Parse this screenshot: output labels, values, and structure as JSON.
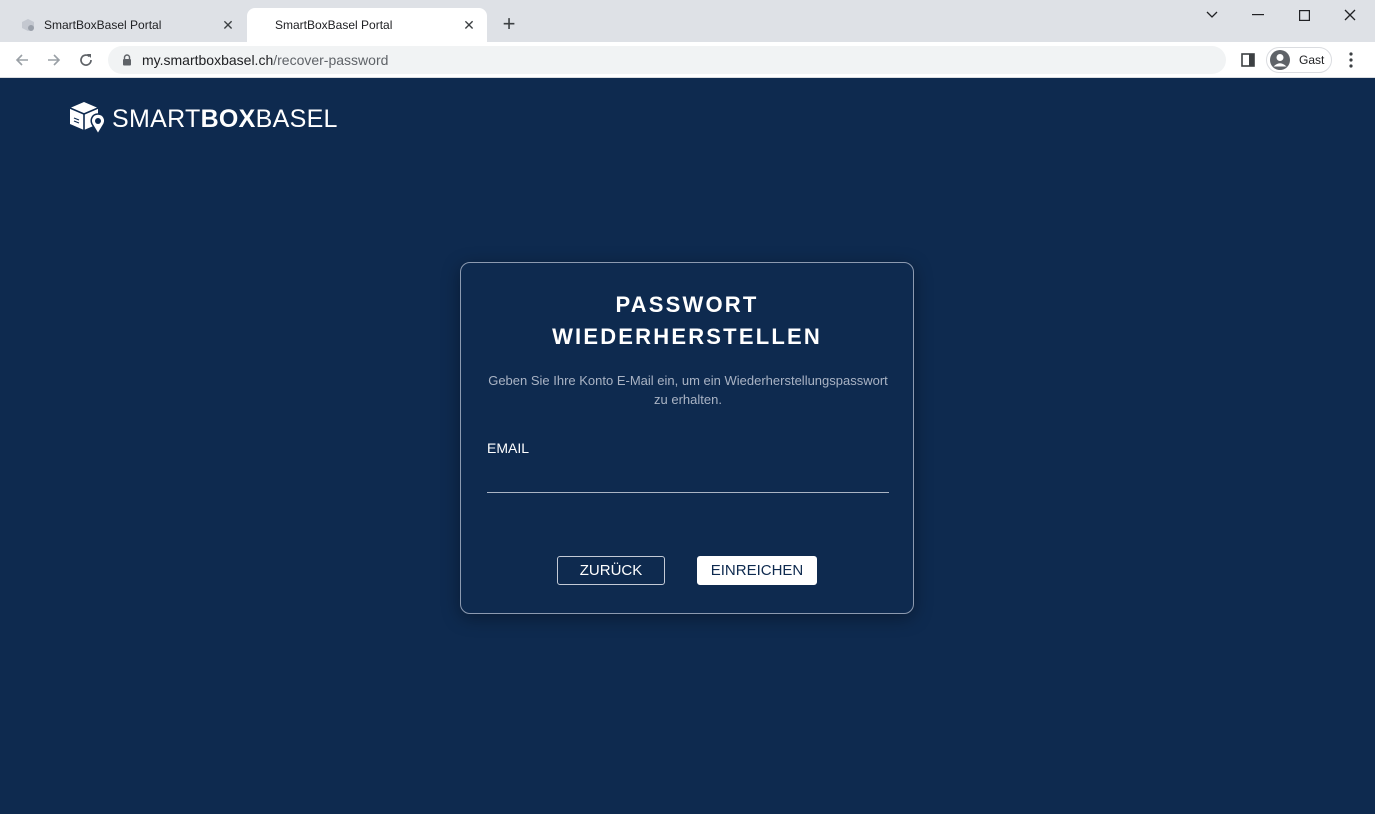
{
  "browser": {
    "tabs": [
      {
        "title": "SmartBoxBasel Portal",
        "active": false
      },
      {
        "title": "SmartBoxBasel Portal",
        "active": true
      }
    ],
    "url_host": "my.smartboxbasel.ch",
    "url_path": "/recover-password",
    "profile_name": "Gast"
  },
  "page": {
    "logo": {
      "part1": "SMART",
      "part2": "BOX",
      "part3": "BASEL"
    },
    "card": {
      "title_line1": "PASSWORT",
      "title_line2": "WIEDERHERSTELLEN",
      "description": "Geben Sie Ihre Konto E-Mail ein, um ein Wiederherstellungspasswort zu erhalten.",
      "email_label": "EMAIL",
      "email_value": "",
      "back_label": "ZURÜCK",
      "submit_label": "EINREICHEN"
    }
  },
  "colors": {
    "background": "#0e2a4f",
    "card_border": "#8c9ab0",
    "button_primary_bg": "#ffffff",
    "text_muted": "#a9b3c4"
  }
}
